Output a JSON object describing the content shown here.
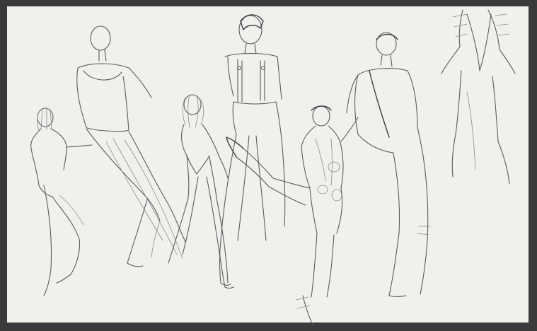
{
  "artwork": {
    "medium": "pencil-sketch",
    "paper_color": "#f1f0ec",
    "frame_color": "#3a3a3c",
    "line_color": "#5b5b60",
    "figures": [
      {
        "name": "figure-back-left-crouching"
      },
      {
        "name": "figure-tall-long-skirt"
      },
      {
        "name": "figure-curly-hair-leotard"
      },
      {
        "name": "figure-suspenders-trousers"
      },
      {
        "name": "figure-kicking-leg"
      },
      {
        "name": "figure-one-shoulder-leotard"
      },
      {
        "name": "figure-top-right-partial"
      }
    ]
  }
}
